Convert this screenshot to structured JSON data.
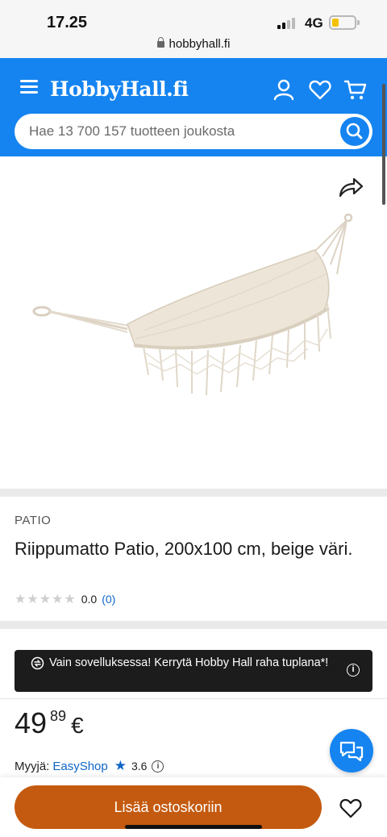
{
  "status_bar": {
    "time": "17.25",
    "network": "4G",
    "url": "hobbyhall.fi"
  },
  "header": {
    "logo": "HobbyHall.fi",
    "search": {
      "placeholder": "Hae 13 700 157 tuotteen joukosta",
      "value": ""
    },
    "icons": [
      "menu-icon",
      "user-icon",
      "heart-icon",
      "cart-icon",
      "search-icon"
    ],
    "brand_color": "#1584f0"
  },
  "product": {
    "brand": "PATIO",
    "title": "Riippumatto Patio, 200x100 cm, beige väri.",
    "rating": {
      "stars": "★★★★★",
      "value": "0.0",
      "count": "(0)"
    },
    "image_icon": "share-icon"
  },
  "promo_banner": {
    "text": "Vain sovelluksessa! Kerrytä Hobby Hall raha tuplana*!",
    "icon": "exchange-icon",
    "info": "i"
  },
  "price": {
    "euros": "49",
    "cents": "89",
    "currency": "€"
  },
  "seller": {
    "label": "Myyjä:",
    "name": "EasyShop",
    "rating": "3.6",
    "info": "i"
  },
  "actions": {
    "add_to_cart": "Lisää ostoskoriin",
    "accent_color": "#c45a0f"
  }
}
